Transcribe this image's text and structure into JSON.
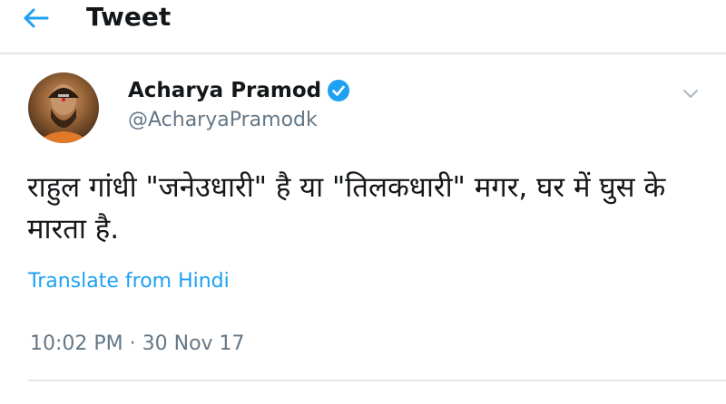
{
  "header": {
    "title": "Tweet",
    "back_icon": "back-arrow-icon"
  },
  "tweet": {
    "author_name": "Acharya Pramod",
    "verified_icon": "verified-badge-icon",
    "handle": "@AcharyaPramodk",
    "menu_icon": "chevron-down-icon",
    "text": "राहुल गांधी \"जनेउधारी\" है या \"तिलकधारी\" मगर, घर में घुस के मारता है.",
    "translate_label": "Translate from Hindi",
    "timestamp": "10:02 PM · 30 Nov 17"
  },
  "colors": {
    "accent": "#1da1f2",
    "secondary_text": "#657786",
    "divider": "#e1e8ed"
  }
}
